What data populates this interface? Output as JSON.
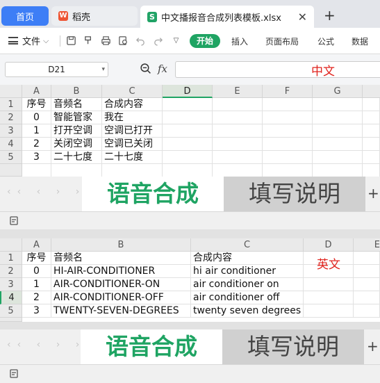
{
  "titlebar": {
    "tabs": [
      {
        "label": "首页"
      },
      {
        "label": "稻壳",
        "icon": "wps-logo"
      },
      {
        "label": "中文播报音合成列表模板.xlsx",
        "icon": "spreadsheet-s-icon"
      }
    ],
    "wps_glyph": "W",
    "sheet_glyph": "S"
  },
  "ribbon": {
    "file_menu": "文件",
    "tabs": [
      "开始",
      "插入",
      "页面布局",
      "公式",
      "数据"
    ],
    "active_tab": "开始"
  },
  "formula_bar": {
    "name_box": "D21",
    "fx": "fx",
    "content": ""
  },
  "colors": {
    "accent": "#1fa463",
    "red_label": "#e0221c"
  },
  "top_sheet": {
    "annotation": "中文",
    "columns": [
      "A",
      "B",
      "C",
      "D",
      "E",
      "F",
      "G"
    ],
    "rows": [
      "1",
      "2",
      "3",
      "4",
      "5"
    ],
    "data": [
      [
        "序号",
        "音频名",
        "合成内容"
      ],
      [
        "0",
        "智能管家",
        "我在"
      ],
      [
        "1",
        "打开空调",
        "空调已打开"
      ],
      [
        "2",
        "关闭空调",
        "空调已关闭"
      ],
      [
        "3",
        "二十七度",
        "二十七度"
      ]
    ],
    "sheet_tabs": {
      "active": "语音合成",
      "other": "填写说明"
    }
  },
  "bottom_sheet": {
    "annotation": "英文",
    "columns": [
      "A",
      "B",
      "C",
      "D",
      "E"
    ],
    "rows": [
      "1",
      "2",
      "3",
      "4",
      "5"
    ],
    "data": [
      [
        "序号",
        "音频名",
        "合成内容"
      ],
      [
        "0",
        "HI-AIR-CONDITIONER",
        "hi air conditioner"
      ],
      [
        "1",
        "AIR-CONDITIONER-ON",
        "air conditioner on"
      ],
      [
        "2",
        "AIR-CONDITIONER-OFF",
        "air conditioner off"
      ],
      [
        "3",
        "TWENTY-SEVEN-DEGREES",
        "twenty seven degrees"
      ]
    ],
    "sheet_tabs": {
      "active": "语音合成",
      "other": "填写说明"
    }
  }
}
